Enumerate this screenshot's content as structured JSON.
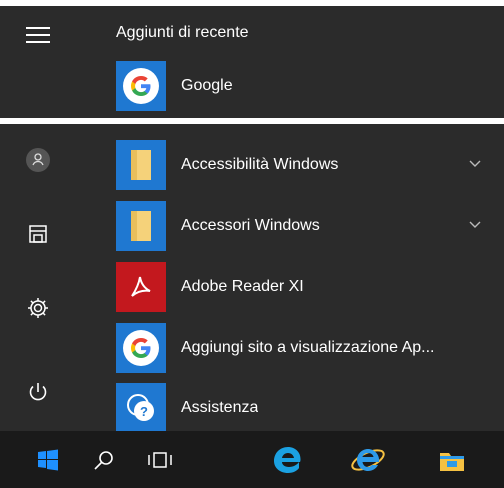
{
  "recent": {
    "title": "Aggiunti di recente",
    "apps": [
      {
        "label": "Google",
        "icon": "google-icon"
      }
    ]
  },
  "all_apps": [
    {
      "label": "Accessibilità Windows",
      "icon": "folder-icon",
      "expandable": true
    },
    {
      "label": "Accessori Windows",
      "icon": "folder-icon",
      "expandable": true
    },
    {
      "label": "Adobe Reader XI",
      "icon": "adobe-reader-icon",
      "expandable": false
    },
    {
      "label": "Aggiungi sito a visualizzazione Ap...",
      "icon": "google-icon",
      "expandable": false
    },
    {
      "label": "Assistenza",
      "icon": "help-chat-icon",
      "expandable": false
    }
  ],
  "left_rail": [
    "hamburger-icon",
    "user-icon",
    "documents-icon",
    "settings-gear-icon",
    "power-icon"
  ],
  "taskbar": [
    "windows-start-icon",
    "search-icon",
    "task-view-icon",
    "edge-icon",
    "internet-explorer-icon",
    "file-explorer-icon"
  ],
  "colors": {
    "panel": "#2b2b2b",
    "taskbar": "#1a1a1a",
    "tile_blue": "#1f78d1",
    "adobe_red": "#c3181e"
  }
}
